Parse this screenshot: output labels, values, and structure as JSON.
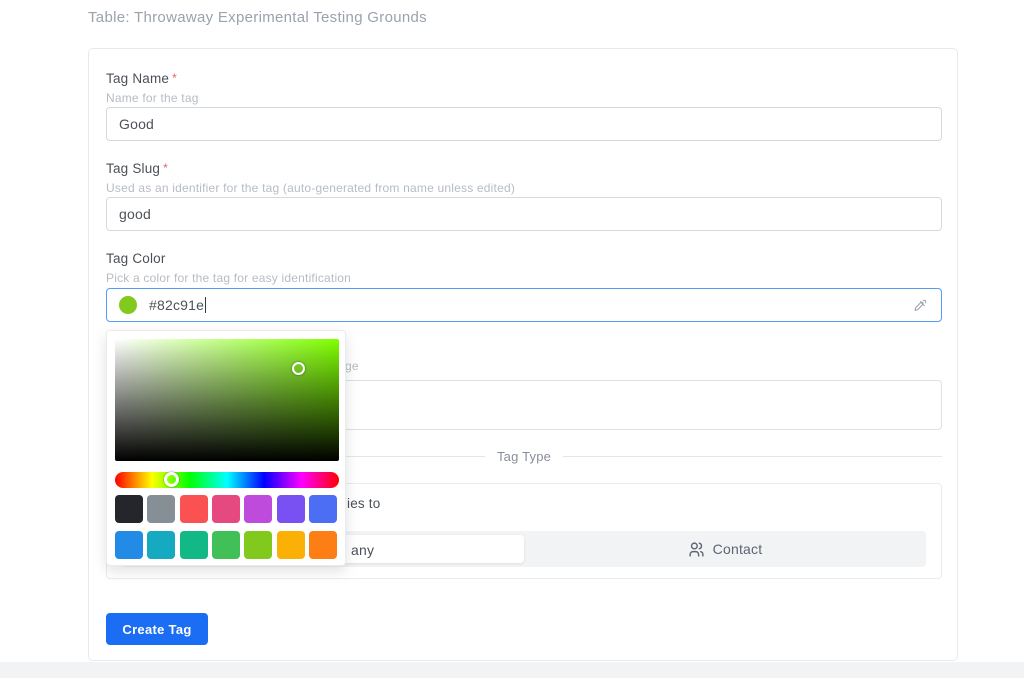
{
  "page": {
    "title": "Table: Throwaway Experimental Testing Grounds"
  },
  "form": {
    "tag_name": {
      "label": "Tag Name",
      "required_mark": "*",
      "helper": "Name for the tag",
      "value": "Good"
    },
    "tag_slug": {
      "label": "Tag Slug",
      "required_mark": "*",
      "helper": "Used as an identifier for the tag (auto-generated from name unless edited)",
      "value": "good"
    },
    "tag_color": {
      "label": "Tag Color",
      "helper": "Pick a color for the tag for easy identification",
      "value": "#82c91e",
      "swatch_color": "#82c91e",
      "right_icon": "eyedropper-icon"
    },
    "obscured_field": {
      "visible_helper_fragment": "ge"
    },
    "tag_type_section": {
      "divider_label": "Tag Type",
      "visible_caption_fragment": "ies to",
      "segmented_control": {
        "active_option_visible_fragment": "any",
        "inactive_option_label": "Contact",
        "inactive_option_icon": "users-icon"
      }
    },
    "submit_button": {
      "label": "Create Tag"
    }
  },
  "color_picker": {
    "selected_hex": "#82c91e",
    "hue_degrees": 90,
    "swatches_row1": [
      "#25262b",
      "#868e96",
      "#fa5252",
      "#e64980",
      "#be4bdb",
      "#7950f2",
      "#4c6ef5"
    ],
    "swatches_row2": [
      "#228be6",
      "#15aabf",
      "#12b886",
      "#40c057",
      "#82c91e",
      "#fab005",
      "#fd7e14"
    ]
  },
  "colors": {
    "accent_blue": "#1b6ef3",
    "focus_border": "#549cf6",
    "required_red": "#ef6262"
  }
}
